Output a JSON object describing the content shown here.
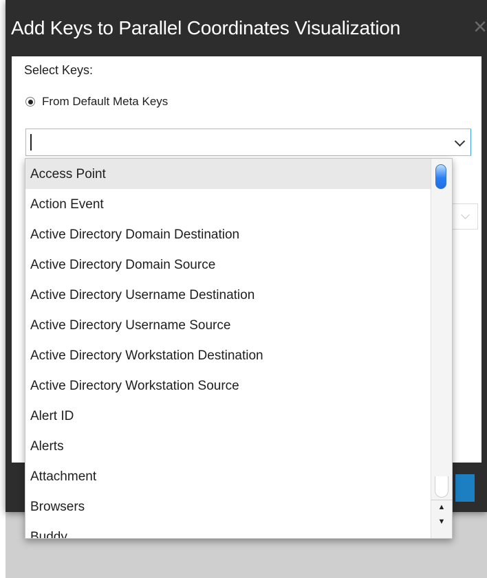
{
  "dialog": {
    "title": "Add Keys to Parallel Coordinates Visualization",
    "close_icon": "×"
  },
  "form": {
    "select_keys_label": "Select Keys:",
    "radio_option_label": "From Default Meta Keys",
    "radio_selected": true,
    "combo_value": ""
  },
  "dropdown": {
    "highlighted_index": 0,
    "items": [
      "Access Point",
      "Action Event",
      "Active Directory Domain Destination",
      "Active Directory Domain Source",
      "Active Directory Username Destination",
      "Active Directory Username Source",
      "Active Directory Workstation Destination",
      "Active Directory Workstation Source",
      "Alert ID",
      "Alerts",
      "Attachment",
      "Browsers",
      "Buddy"
    ],
    "scroll_up_glyph": "▲",
    "scroll_down_glyph": "▼"
  },
  "colors": {
    "title_bar": "#2d2d2d",
    "accent": "#1b7fc1",
    "highlight": "#e8e8e8"
  }
}
